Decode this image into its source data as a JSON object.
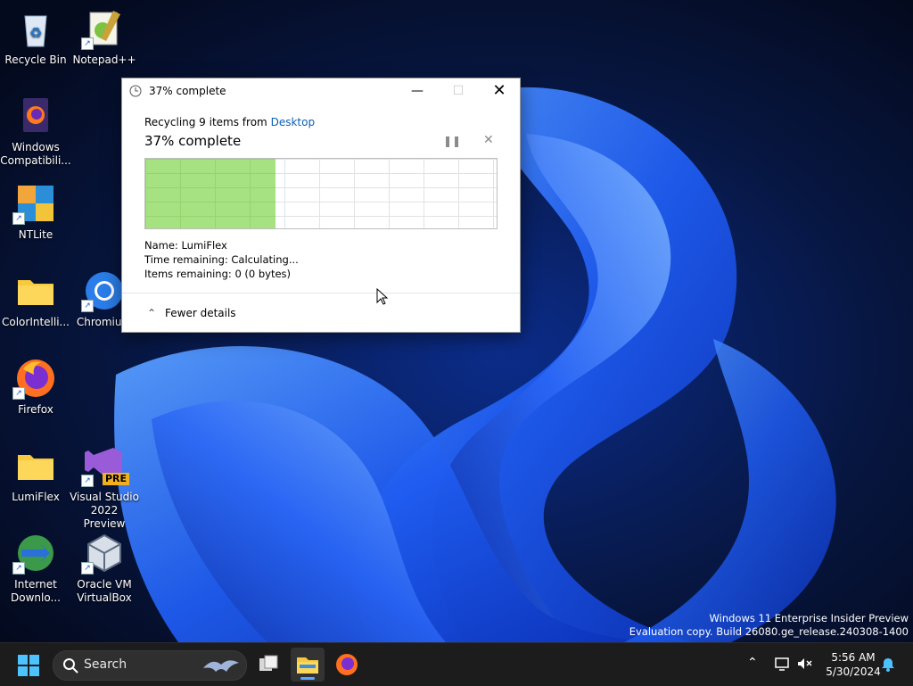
{
  "dialog": {
    "title": "37% complete",
    "subtitle_prefix": "Recycling 9 items from",
    "subtitle_link": "Desktop",
    "percent_text": "37% complete",
    "progress": 0.37,
    "details": {
      "name_label": "Name:",
      "name_value": "LumiFlex",
      "time_label": "Time remaining:",
      "time_value": "Calculating...",
      "items_label": "Items remaining:",
      "items_value": "0 (0 bytes)"
    },
    "fewer_details": "Fewer details"
  },
  "desktop": {
    "icons": [
      {
        "label": "Recycle Bin"
      },
      {
        "label": "Notepad++"
      },
      {
        "label": "Windows Compatibili..."
      },
      {
        "label": "NTLite"
      },
      {
        "label": "ColorIntelli..."
      },
      {
        "label": "Chromium"
      },
      {
        "label": "Firefox"
      },
      {
        "label": "LumiFlex"
      },
      {
        "label": "Visual Studio 2022 Preview",
        "badge": "PRE"
      },
      {
        "label": "Internet Downlo..."
      },
      {
        "label": "Oracle VM VirtualBox"
      }
    ]
  },
  "watermark": {
    "line1": "Windows 11 Enterprise Insider Preview",
    "line2": "Evaluation copy. Build 26080.ge_release.240308-1400"
  },
  "taskbar": {
    "search_placeholder": "Search",
    "clock_time": "5:56 AM",
    "clock_date": "5/30/2024"
  },
  "colors": {
    "progress_fill": "#a6e282",
    "link": "#0a5fb4",
    "taskbar": "#1c1c1c",
    "accent": "#5aa8ff"
  }
}
